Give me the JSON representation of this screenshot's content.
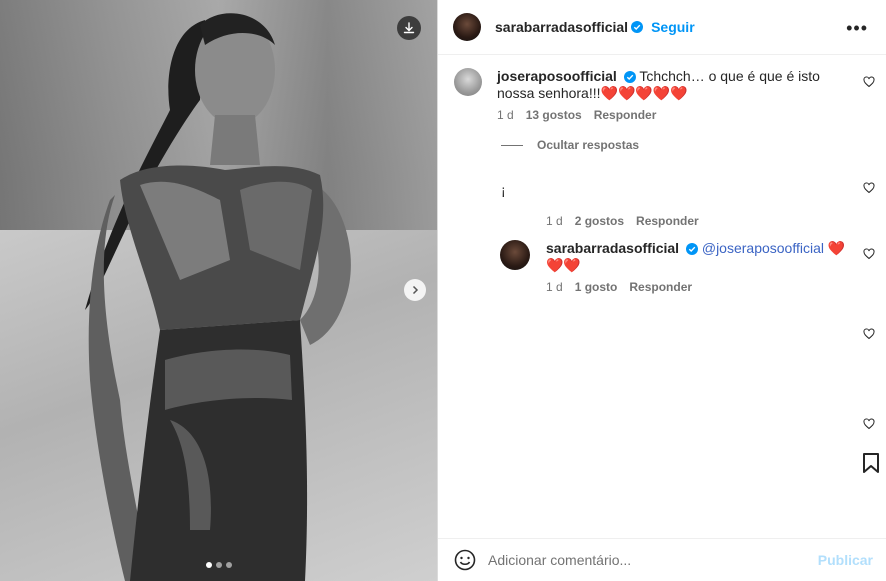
{
  "post": {
    "author": "sarabarradasofficial",
    "follow_label": "Seguir",
    "more_icon": "more-horizontal-icon",
    "carousel": {
      "slides": 3,
      "active": 1
    }
  },
  "comments": [
    {
      "author": "joseraposoofficial",
      "text": "Tchchch… o que é que é isto nossa senhora!!!",
      "emoji": "❤️❤️❤️❤️❤️",
      "time": "1 d",
      "likes": "13 gostos",
      "reply": "Responder"
    }
  ],
  "hide_replies_label": "Ocultar respostas",
  "replies": [
    {
      "text": "¡",
      "time": "1 d",
      "likes": "2 gostos",
      "reply": "Responder"
    },
    {
      "author": "sarabarradasofficial",
      "mention": "@joseraposoofficial",
      "emoji": "❤️❤️❤️",
      "time": "1 d",
      "likes": "1 gosto",
      "reply": "Responder"
    }
  ],
  "footer": {
    "placeholder": "Adicionar comentário...",
    "post_label": "Publicar"
  },
  "colors": {
    "accent": "#0095f6",
    "verified": "#0095f6",
    "heart": "#e0245e"
  }
}
